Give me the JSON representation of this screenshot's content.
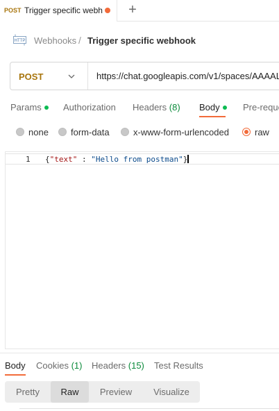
{
  "tab": {
    "method": "POST",
    "title": "Trigger specific webh",
    "unsaved_color": "#f26b3a",
    "new_tab_label": "+"
  },
  "breadcrumb": {
    "icon": "http-icon",
    "icon_text": "HTTP",
    "parent": "Webhooks",
    "separator": "/",
    "current": "Trigger specific webhook"
  },
  "request": {
    "method": "POST",
    "url": "https://chat.googleapis.com/v1/spaces/AAAAL"
  },
  "request_tabs": [
    {
      "label": "Params",
      "dot": true
    },
    {
      "label": "Authorization"
    },
    {
      "label": "Headers",
      "count": "(8)"
    },
    {
      "label": "Body",
      "dot": true,
      "active": true
    },
    {
      "label": "Pre-reque"
    }
  ],
  "body_types": [
    {
      "label": "none",
      "selected": false
    },
    {
      "label": "form-data",
      "selected": false
    },
    {
      "label": "x-www-form-urlencoded",
      "selected": false
    },
    {
      "label": "raw",
      "selected": true
    }
  ],
  "editor": {
    "line_number": "1",
    "brace_open": "{",
    "key": "\"text\"",
    "colon": " : ",
    "value": "\"Hello from postman\"",
    "brace_close": "}"
  },
  "response_tabs": [
    {
      "label": "Body",
      "active": true
    },
    {
      "label": "Cookies",
      "count": "(1)"
    },
    {
      "label": "Headers",
      "count": "(15)"
    },
    {
      "label": "Test Results"
    }
  ],
  "view_modes": [
    {
      "label": "Pretty"
    },
    {
      "label": "Raw",
      "active": true
    },
    {
      "label": "Preview"
    },
    {
      "label": "Visualize"
    }
  ],
  "colors": {
    "accent": "#f26b3a",
    "method": "#a8750d",
    "status_dot": "#0cbb52"
  }
}
